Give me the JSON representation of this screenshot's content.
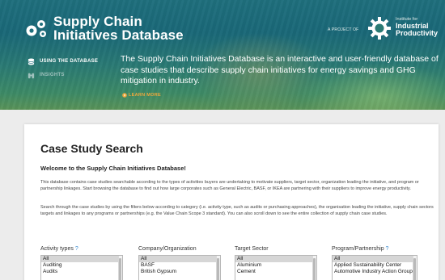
{
  "header": {
    "title_line1": "Supply Chain",
    "title_line2": "Initiatives Database",
    "project_of": "A PROJECT OF",
    "iip": {
      "line1": "Institute for",
      "line2": "Industrial",
      "line3": "Productivity"
    },
    "logo_icon": "sca-logo-icon",
    "iip_logo_icon": "iip-gear-logo-icon"
  },
  "nav": {
    "items": [
      {
        "label": "USING THE DATABASE",
        "icon": "database-icon",
        "active": true
      },
      {
        "label": "INSIGHTS",
        "icon": "binoculars-icon",
        "active": false
      }
    ]
  },
  "intro": {
    "text": "The Supply Chain Initiatives Database is an interactive and user-friendly database of case studies that describe supply chain initiatives for energy savings and GHG mitigation in industry.",
    "learn_more": "LEARN MORE"
  },
  "main": {
    "title": "Case Study Search",
    "welcome": "Welcome to the Supply Chain Initiatives Database!",
    "para1": "This database contains case studies searchable according to the types of activities buyers are undertaking to motivate suppliers, target sector, organization leading the initiative, and program or partnership linkages. Start browsing the database to find out how large corporates such as General Electric, BASF, or IKEA are partnering with their suppliers to improve energy productivity.",
    "para2": "Search through the case studies by using the filters below according to category (i.e. activity type, such as audits or purchasing approaches), the organisation leading the initiative, supply chain sectors targets and linkages to any programs or partnerships (e.g. the Value Chain Scope 3 standard). You can also scroll down to see the entire collection of supply chain case studies."
  },
  "filters": [
    {
      "label": "Activity types",
      "help": "?",
      "options": [
        "All",
        "Auditing",
        "Audits"
      ]
    },
    {
      "label": "Company/Organization",
      "help": "",
      "options": [
        "All",
        "BASF",
        "British Gypsum"
      ]
    },
    {
      "label": "Target Sector",
      "help": "",
      "options": [
        "All",
        "Aluminium",
        "Cement"
      ]
    },
    {
      "label": "Program/Partnership",
      "help": "?",
      "options": [
        "All",
        "Applied Sustainability Center",
        "Automotive Industry Action Group"
      ]
    }
  ],
  "colors": {
    "accent_orange": "#f0a83c",
    "help_blue": "#3a8bd0",
    "header_teal": "#1f6f7d"
  }
}
